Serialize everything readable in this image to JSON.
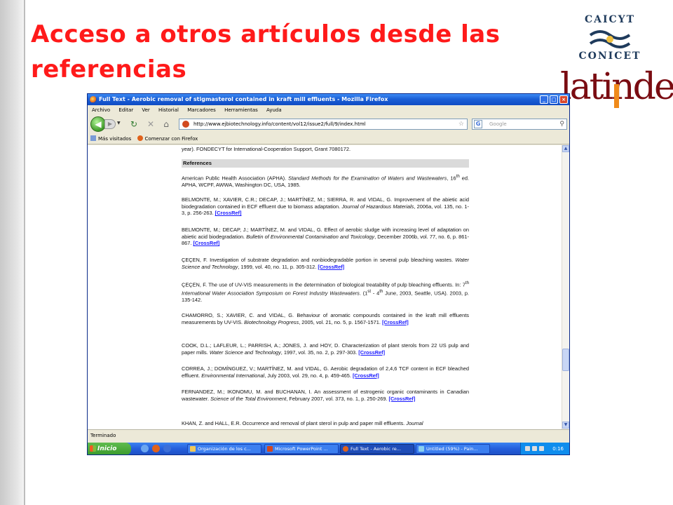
{
  "slide": {
    "title": "Acceso a otros artículos desde las referencias",
    "logo_caicyt_top": "CAICYT",
    "logo_caicyt_bottom": "CONICET",
    "logo_latindex": "latindex"
  },
  "browser": {
    "window_title": "Full Text - Aerobic removal of stigmasterol contained in kraft mill effluents - Mozilla Firefox",
    "menu": [
      "Archivo",
      "Editar",
      "Ver",
      "Historial",
      "Marcadores",
      "Herramientas",
      "Ayuda"
    ],
    "url": "http://www.ejbiotechnology.info/content/vol12/issue2/full/9/index.html",
    "search_placeholder": "Google",
    "bookmarks": [
      "Más visitados",
      "Comenzar con Firefox"
    ],
    "status": "Terminado"
  },
  "page": {
    "top_line": "year). FONDECYT for International-Cooperation Support, Grant 7080172.",
    "references_heading": "References",
    "crossref_label": "[CrossRef]",
    "refs": [
      {
        "text": "American Public Health Association (APHA). Standard Methods for the Examination of Waters and Wastewaters, 16th ed. APHA, WCPF, AWWA, Washington DC, USA, 1985.",
        "crossref": false
      },
      {
        "text": "BELMONTE, M.; XAVIER, C.R.; DECAP, J.; MARTÍNEZ, M.; SIERRA, R. and VIDAL, G. Improvement of the abietic acid biodegradation contained in ECF effluent due to biomass adaptation. Journal of Hazardous Materials, 2006a, vol. 135, no. 1-3, p. 256-263.",
        "crossref": true
      },
      {
        "text": "BELMONTE, M.; DECAP, J.; MARTÍNEZ, M. and VIDAL, G. Effect of aerobic sludge with increasing level of adaptation on abietic acid biodegradation. Bulletin of Environmental Contamination and Toxicology, December 2006b, vol. 77, no. 6, p. 861-867.",
        "crossref": true
      },
      {
        "text": "ÇEÇEN, F. Investigation of substrate degradation and nonbiodegradable portion in several pulp bleaching wastes. Water Science and Technology, 1999, vol. 40, no. 11, p. 305-312.",
        "crossref": true
      },
      {
        "text": "ÇEÇEN, F. The use of UV-VIS measurements in the determination of biological treatability of pulp bleaching effluents. In: 7th International Water Association Symposium on Forest Industry Wastewaters. (1st - 4th June, 2003, Seattle, USA). 2003, p. 135-142.",
        "crossref": false
      },
      {
        "text": "CHAMORRO, S.; XAVIER, C. and VIDAL, G. Behaviour of aromatic compounds contained in the kraft mill effluents measurements by UV-VIS. Biotechnology Progress, 2005, vol. 21, no. 5, p. 1567-1571.",
        "crossref": true
      },
      {
        "text": "COOK, D.L.; LAFLEUR, L.; PARRISH, A.; JONES, J. and HOY, D. Characterization of plant sterols from 22 US pulp and paper mills. Water Science and Technology, 1997, vol. 35, no. 2, p. 297-303.",
        "crossref": true
      },
      {
        "text": "CORREA, J.; DOMÍNGUEZ, V.; MARTÍNEZ, M. and VIDAL, G. Aerobic degradation of 2,4,6 TCF content in ECF bleached effluent. Environmental International, July 2003, vol. 29, no. 4, p. 459-465.",
        "crossref": true
      },
      {
        "text": "FERNANDEZ, M.; IKONOMU, M. and BUCHANAN, I. An assessment of estrogenic organic contaminants in Canadian wastewater. Science of the Total Environment, February 2007, vol. 373, no. 1, p. 250-269.",
        "crossref": true
      },
      {
        "text": "KHAN, Z. and HALL, E.R. Occurrence and removal of plant sterol in pulp and paper mill effluents. Journal",
        "crossref": false
      }
    ]
  },
  "taskbar": {
    "start_label": "Inicio",
    "tasks": [
      "Organización de los c...",
      "Microsoft PowerPoint ...",
      "Full Text - Aerobic re...",
      "Untitled (59%) - Pain..."
    ],
    "clock": "0:16"
  },
  "colors": {
    "title_red": "#ff1a1a",
    "link_blue": "#1a1aff",
    "xp_blue": "#245edb"
  }
}
